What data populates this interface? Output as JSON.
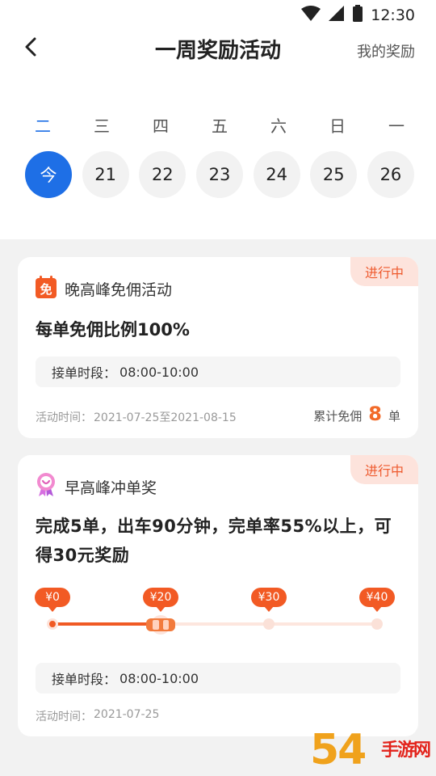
{
  "status_bar": {
    "time": "12:30"
  },
  "header": {
    "title": "一周奖励活动",
    "right_link": "我的奖励"
  },
  "calendar": {
    "weekdays": [
      "二",
      "三",
      "四",
      "五",
      "六",
      "日",
      "一"
    ],
    "dates": [
      "今",
      "21",
      "22",
      "23",
      "24",
      "25",
      "26"
    ],
    "selected_index": 0
  },
  "cards": [
    {
      "badge": "进行中",
      "icon": "free-commission-icon",
      "name": "晚高峰免佣活动",
      "desc": "每单免佣比例100%",
      "period_label": "接单时段：",
      "period_value": "08:00-10:00",
      "time_label": "活动时间：",
      "time_value": "2021-07-25至2021-08-15",
      "stat_label": "累计免佣",
      "stat_value": "8",
      "stat_unit": "单"
    },
    {
      "badge": "进行中",
      "icon": "medal-icon",
      "name": "早高峰冲单奖",
      "desc": "完成5单，出车90分钟，完单率55%以上，可得30元奖励",
      "milestones": [
        "¥0",
        "¥20",
        "¥30",
        "¥40"
      ],
      "progress_value": "¥20",
      "period_label": "接单时段：",
      "period_value": "08:00-10:00",
      "time_label": "活动时间：",
      "time_value": "2021-07-25"
    }
  ],
  "watermark": {
    "digits": "54",
    "text": "手游网"
  },
  "colors": {
    "accent": "#1e6fe6",
    "orange": "#f05a24",
    "badge_bg": "#fde3dc"
  }
}
